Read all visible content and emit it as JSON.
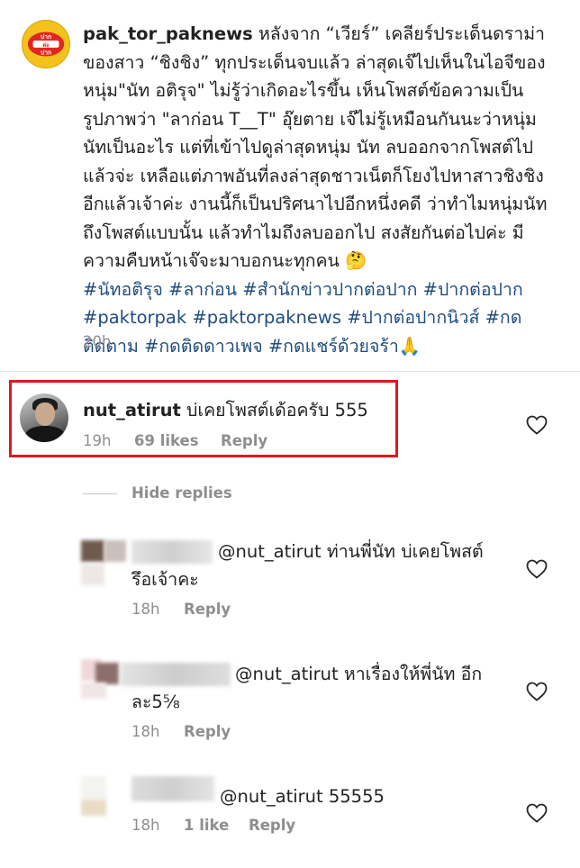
{
  "post": {
    "avatar_text": "ปาก ต่อ ปาก",
    "username": "pak_tor_paknews",
    "caption": "หลังจาก “เวียร์” เคลียร์ประเด็นดราม่าของสาว “ชิงชิง” ทุกประเด็นจบแล้ว  ล่าสุดเจ๊ไปเห็นในไอจีของหนุ่ม\"นัท อติรุจ\" ไม่รู้ว่าเกิดอะไรขึ้น เห็นโพสต์ข้อความเป็นรูปภาพว่า \"ลาก่อน T__T\"  อุ๊ยตาย เจ๊ไม่รู้เหมือนกันนะว่าหนุ่มนัทเป็นอะไร แต่ที่เข้าไปดูล่าสุดหนุ่ม นัท ลบออกจากโพสต์ไปแล้วจ่ะ เหลือแต่ภาพอันที่ลงล่าสุดชาวเน็ตก็โยงไปหาสาวชิงชิงอีกแล้วเจ้าค่ะ  งานนี้ก็เป็นปริศนาไปอีกหนึ่งคดี ว่าทำไมหนุ่มนัทถึงโพสต์แบบนั้น แล้วทำไมถึงลบออกไป สงสัยกันต่อไปค่ะ มีความคืบหน้าเจ๊จะมาบอกนะทุกคน 🤔",
    "hashtags": "#นัทอติรุจ #ลาก่อน  #สำนักข่าวปากต่อปาก #ปากต่อปาก #paktorpak #paktorpaknews #ปากต่อปากนิวส์ #กดติดตาม #กดติดดาวเพจ #กดแชร์ด้วยจร้า🙏",
    "time": "20h"
  },
  "highlighted_comment": {
    "username": "nut_atirut",
    "text": "บ่เคยโพสต์เด้อครับ 555",
    "time": "19h",
    "likes": "69 likes",
    "reply": "Reply"
  },
  "hide_replies": "Hide replies",
  "replies": [
    {
      "mention": "@nut_atirut",
      "text_line1": "ท่านพี่นัท บ่เคยโพสต์",
      "text_line2": "รึอเจ้าคะ",
      "time": "18h",
      "reply": "Reply"
    },
    {
      "mention": "@nut_atirut",
      "text_line1": "หาเรื่องให้พี่นัท อีก",
      "text_line2": "ละ5⅝",
      "time": "18h",
      "reply": "Reply"
    },
    {
      "mention": "@nut_atirut",
      "text_line1": "55555",
      "time": "18h",
      "likes": "1 like",
      "reply": "Reply"
    }
  ],
  "colors": {
    "highlight_border": "#e0171f",
    "hashtag": "#1f4d7f",
    "meta_text": "#8e8e8e"
  }
}
